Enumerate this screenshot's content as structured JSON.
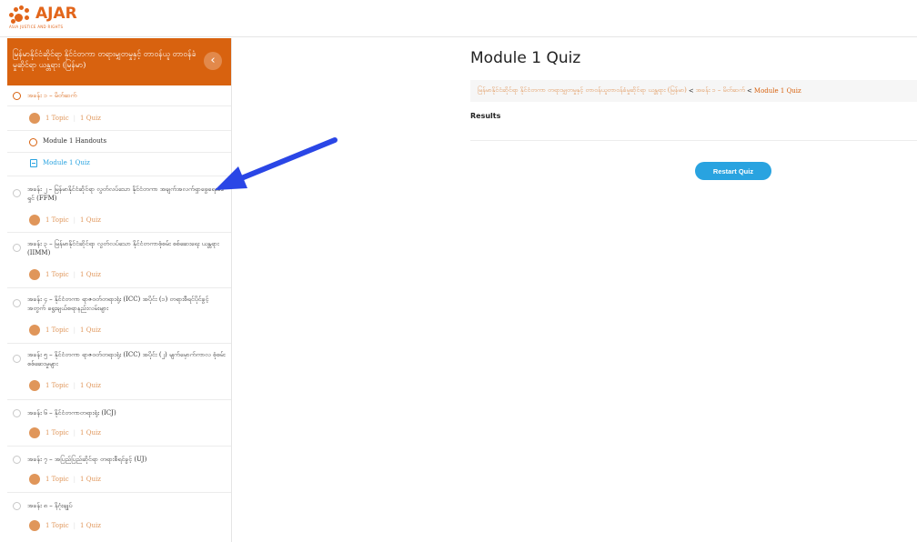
{
  "brand": {
    "name": "AJAR",
    "tagline": "ASIA JUSTICE AND RIGHTS",
    "accent": "#d8620f",
    "link": "#29a3e0"
  },
  "sidebar": {
    "course_title": "မြန်မာနိုင်ငံဆိုင်ရာ နိုင်ငံတကာ တရားမျှတမှုနှင့် တာဝန်ယူ တာဝန်ခံမှုဆိုင်ရာ ယန္တရား (မြန်မာ)",
    "toggle_icon": "‹",
    "lessons": [
      {
        "title": "အခန်း ၁ – မိတ်ဆက်",
        "topic": "1 Topic",
        "quiz": "1 Quiz"
      },
      {
        "title": "အခန်း ၂ – မြန်မာနိုင်ငံဆိုင်ရာ လွတ်လပ်သော နိုင်ငံတကာ အချက်အလက်ရှာဖွေရေးမစ်ရှင် (FFM)",
        "topic": "1 Topic",
        "quiz": "1 Quiz"
      },
      {
        "title": "အခန်း ၃ – မြန်မာနိုင်ငံဆိုင်ရာ လွတ်လပ်သော နိုင်ငံတကာစုံစမ်း စစ်ဆေးရေး ယန္တရား (IIMM)",
        "topic": "1 Topic",
        "quiz": "1 Quiz"
      },
      {
        "title": "အခန်း ၄ – နိုင်ငံတကာ ရာဇဝတ်တရားရုံး (ICC) အပိုင်း (၁) တရားစီရင်ပိုင်ခွင့်အတွက် ရွေးချယ်စရာနည်းလမ်းများ",
        "topic": "1 Topic",
        "quiz": "1 Quiz"
      },
      {
        "title": "အခန်း ၅ – နိုင်ငံတကာ ရာဇဝတ်တရားရုံး (ICC) အပိုင်း (၂) မျက်မှောက်ကာလ စုံစမ်းစစ်ဆေးမှုများ",
        "topic": "1 Topic",
        "quiz": "1 Quiz"
      },
      {
        "title": "အခန်း ၆ – နိုင်ငံတကာတရားရုံး (ICJ)",
        "topic": "1 Topic",
        "quiz": "1 Quiz"
      },
      {
        "title": "အခန်း ၇ – အပြည်ပြည်ဆိုင်ရာ တရားစီရင်ခွင့် (UJ)",
        "topic": "1 Topic",
        "quiz": "1 Quiz"
      },
      {
        "title": "အခန်း ၈ – နိဂုံးချုပ်",
        "topic": "1 Topic",
        "quiz": "1 Quiz"
      }
    ],
    "sub_items": {
      "handouts": "Module 1 Handouts",
      "quiz": "Module 1 Quiz"
    }
  },
  "main": {
    "title": "Module 1 Quiz",
    "breadcrumb": {
      "course": "မြန်မာနိုင်ငံဆိုင်ရာ နိုင်ငံတကာ တရားမျှတမှုနှင့် တာဝန်ယူတာဝန်ခံမှုဆိုင်ရာ ယန္တရား (မြန်မာ)",
      "sep": "<",
      "lesson": "အခန်း ၁ – မိတ်ဆက်",
      "current": "Module 1 Quiz"
    },
    "results_label": "Results",
    "restart_label": "Restart Quiz"
  }
}
